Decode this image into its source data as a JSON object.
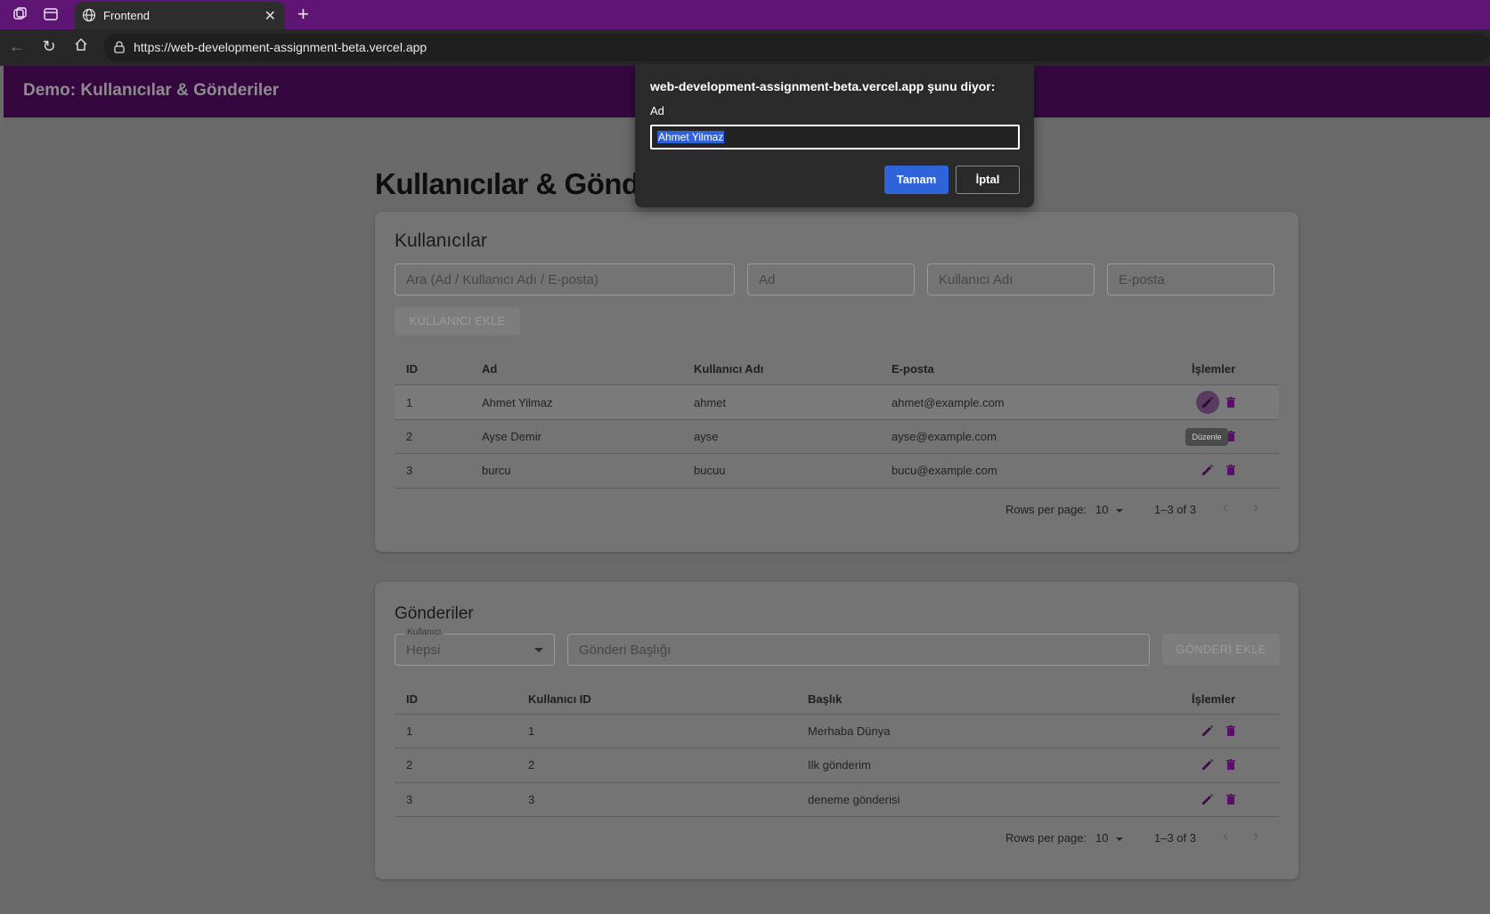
{
  "browser": {
    "tab_title": "Frontend",
    "url": "https://web-development-assignment-beta.vercel.app"
  },
  "app": {
    "header_title": "Demo: Kullanıcılar & Gönderiler",
    "page_title": "Kullanıcılar & Gönder"
  },
  "users": {
    "title": "Kullanıcılar",
    "search_placeholder": "Ara (Ad / Kullanıcı Adı / E-posta)",
    "name_placeholder": "Ad",
    "username_placeholder": "Kullanıcı Adı",
    "email_placeholder": "E-posta",
    "add_button": "KULLANICI EKLE",
    "columns": [
      "ID",
      "Ad",
      "Kullanıcı Adı",
      "E-posta",
      "İşlemler"
    ],
    "rows": [
      {
        "id": "1",
        "name": "Ahmet Yilmaz",
        "username": "ahmet",
        "email": "ahmet@example.com"
      },
      {
        "id": "2",
        "name": "Ayse Demir",
        "username": "ayse",
        "email": "ayse@example.com"
      },
      {
        "id": "3",
        "name": "burcu",
        "username": "bucuu",
        "email": "bucu@example.com"
      }
    ],
    "rows_per_page_label": "Rows per page:",
    "rows_per_page": "10",
    "range": "1–3 of 3",
    "tooltip": "Düzenle"
  },
  "posts": {
    "title": "Gönderiler",
    "user_select_label": "Kullanıcı",
    "user_select_value": "Hepsi",
    "title_placeholder": "Gönderi Başlığı",
    "add_button": "GÖNDERİ EKLE",
    "columns": [
      "ID",
      "Kullanıcı ID",
      "Başlık",
      "İşlemler"
    ],
    "rows": [
      {
        "id": "1",
        "user_id": "1",
        "title": "Merhaba Dünya"
      },
      {
        "id": "2",
        "user_id": "2",
        "title": "Ilk gönderim"
      },
      {
        "id": "3",
        "user_id": "3",
        "title": "deneme gönderisi"
      }
    ],
    "rows_per_page_label": "Rows per page:",
    "rows_per_page": "10",
    "range": "1–3 of 3"
  },
  "dialog": {
    "title": "web-development-assignment-beta.vercel.app şunu diyor:",
    "label": "Ad",
    "value": "Ahmet Yilmaz",
    "ok": "Tamam",
    "cancel": "İptal"
  },
  "colors": {
    "tabbar": "#5f1573",
    "appbar": "#34083f",
    "action_icon": "#3d0b46",
    "delete_icon": "#5a0d6b",
    "dialog_ok": "#2f63d9"
  }
}
